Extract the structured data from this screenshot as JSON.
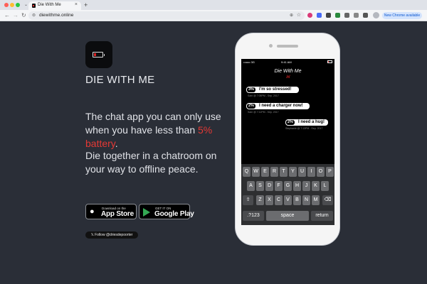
{
  "browser": {
    "tab_title": "Die With Me",
    "tab_close": "×",
    "new_tab": "+",
    "url": "diewithme.online",
    "site_info_icon": "⊜",
    "zoom_icon": "⊕",
    "star_icon": "☆",
    "back_icon": "←",
    "forward_icon": "→",
    "reload_icon": "↻",
    "tab_list_icon": "⌄",
    "update_pill": "New Chrome available"
  },
  "hero": {
    "app_name": "DIE WITH ME",
    "tagline_part1": "The chat app you can only use when you have less than ",
    "tagline_highlight": "5% battery",
    "tagline_part2": ".",
    "subline": "Die together in a chatroom on your way to offline peace.",
    "accent_color": "#e53935"
  },
  "store_buttons": {
    "appstore_small": "Download on the",
    "appstore_big": "App Store",
    "googleplay_small": "GET IT ON",
    "googleplay_big": "Google Play"
  },
  "social": {
    "follow_label": "𝕏 Follow @driesdepoorter"
  },
  "phone": {
    "carrier": "••ooo 3G",
    "time": "9:41 AM",
    "chat_title": "Die With Me",
    "chat_logo": "ꟽ",
    "messages": [
      {
        "pct": "3%",
        "text": "I'm so stressed!",
        "meta": "Sam @ 7:05PM - Sep. 2017"
      },
      {
        "pct": "2%",
        "text": "I need a charger now!",
        "meta": "Sam @ 7:11PM - Sep. 2017"
      },
      {
        "pct": "2%",
        "text": "I need a hug!",
        "meta": "Stephanie @ 7:13PM - Sep. 2017"
      }
    ],
    "keyboard": {
      "row1": [
        "Q",
        "W",
        "E",
        "R",
        "T",
        "Y",
        "U",
        "I",
        "O",
        "P"
      ],
      "row2": [
        "A",
        "S",
        "D",
        "F",
        "G",
        "H",
        "J",
        "K",
        "L"
      ],
      "row3": [
        "⇧",
        "Z",
        "X",
        "C",
        "V",
        "B",
        "N",
        "M",
        "⌫"
      ],
      "bottom": [
        ".?123",
        "space",
        "return"
      ]
    }
  }
}
